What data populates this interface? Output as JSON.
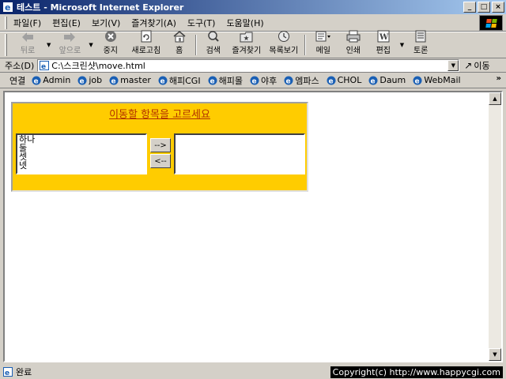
{
  "window": {
    "title": "테스트 - Microsoft Internet Explorer"
  },
  "menu": [
    "파일(F)",
    "편집(E)",
    "보기(V)",
    "즐겨찾기(A)",
    "도구(T)",
    "도움말(H)"
  ],
  "toolbar": {
    "back": "뒤로",
    "forward": "앞으로",
    "stop": "중지",
    "refresh": "새로고침",
    "home": "홈",
    "search": "검색",
    "favorites": "즐겨찾기",
    "history": "목록보기",
    "mail": "메일",
    "print": "인쇄",
    "edit": "편집",
    "discuss": "토론"
  },
  "address": {
    "label": "주소(D)",
    "value": "C:\\스크린샷\\move.html",
    "go": "이동"
  },
  "links": {
    "label": "연결",
    "items": [
      "Admin",
      "job",
      "master",
      "해피CGI",
      "해피몰",
      "야후",
      "엠파스",
      "CHOL",
      "Daum",
      "WebMail"
    ],
    "more": "»"
  },
  "page": {
    "title": "이동할 항목을 고르세요",
    "left_options": [
      "하나",
      "둘",
      "셋",
      "넷"
    ],
    "right_options": [],
    "btn_right": "-->",
    "btn_left": "<--"
  },
  "status": {
    "text": "완료",
    "copyright": "Copyright(c) http://www.happycgi.com"
  },
  "colors": {
    "panel": "#ffcc00",
    "title_link": "#b03000",
    "titlebar": "#0a246a"
  }
}
